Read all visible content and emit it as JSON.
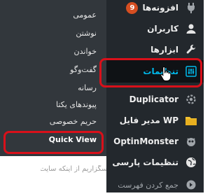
{
  "main": {
    "partial_text": "سپاسگزاریم از اینکه سایت"
  },
  "admin_menu": {
    "items": [
      {
        "label": "افزونه‌ها",
        "icon": "plugin-icon",
        "badge": "9"
      },
      {
        "label": "کاربران",
        "icon": "users-icon"
      },
      {
        "label": "ابزارها",
        "icon": "tools-icon"
      },
      {
        "label": "تنظیمات",
        "icon": "settings-icon",
        "current": true
      },
      {
        "label": "Duplicator",
        "icon": "duplicator-gear-icon"
      },
      {
        "label": "WP مدیر فایل",
        "icon": "folder-icon"
      },
      {
        "label": "OptinMonster",
        "icon": "optinmonster-icon"
      },
      {
        "label": "تنظیمات پارسی",
        "icon": "globe-icon"
      },
      {
        "label": "جمع کردن فهرست",
        "icon": "collapse-icon"
      }
    ]
  },
  "settings_submenu": {
    "items": [
      {
        "label": "عمومی"
      },
      {
        "label": "نوشتن"
      },
      {
        "label": "خواندن"
      },
      {
        "label": "گفت‌وگو"
      },
      {
        "label": "رسانه"
      },
      {
        "label": "پیوندهای یکتا"
      },
      {
        "label": "حریم خصوصی"
      },
      {
        "label": "Quick View"
      }
    ]
  },
  "colors": {
    "menu_bg": "#23282d",
    "submenu_bg": "#32373c",
    "current_bg": "#0f1215",
    "accent": "#00b9eb",
    "badge": "#d54e21",
    "highlight": "#d9101a"
  }
}
